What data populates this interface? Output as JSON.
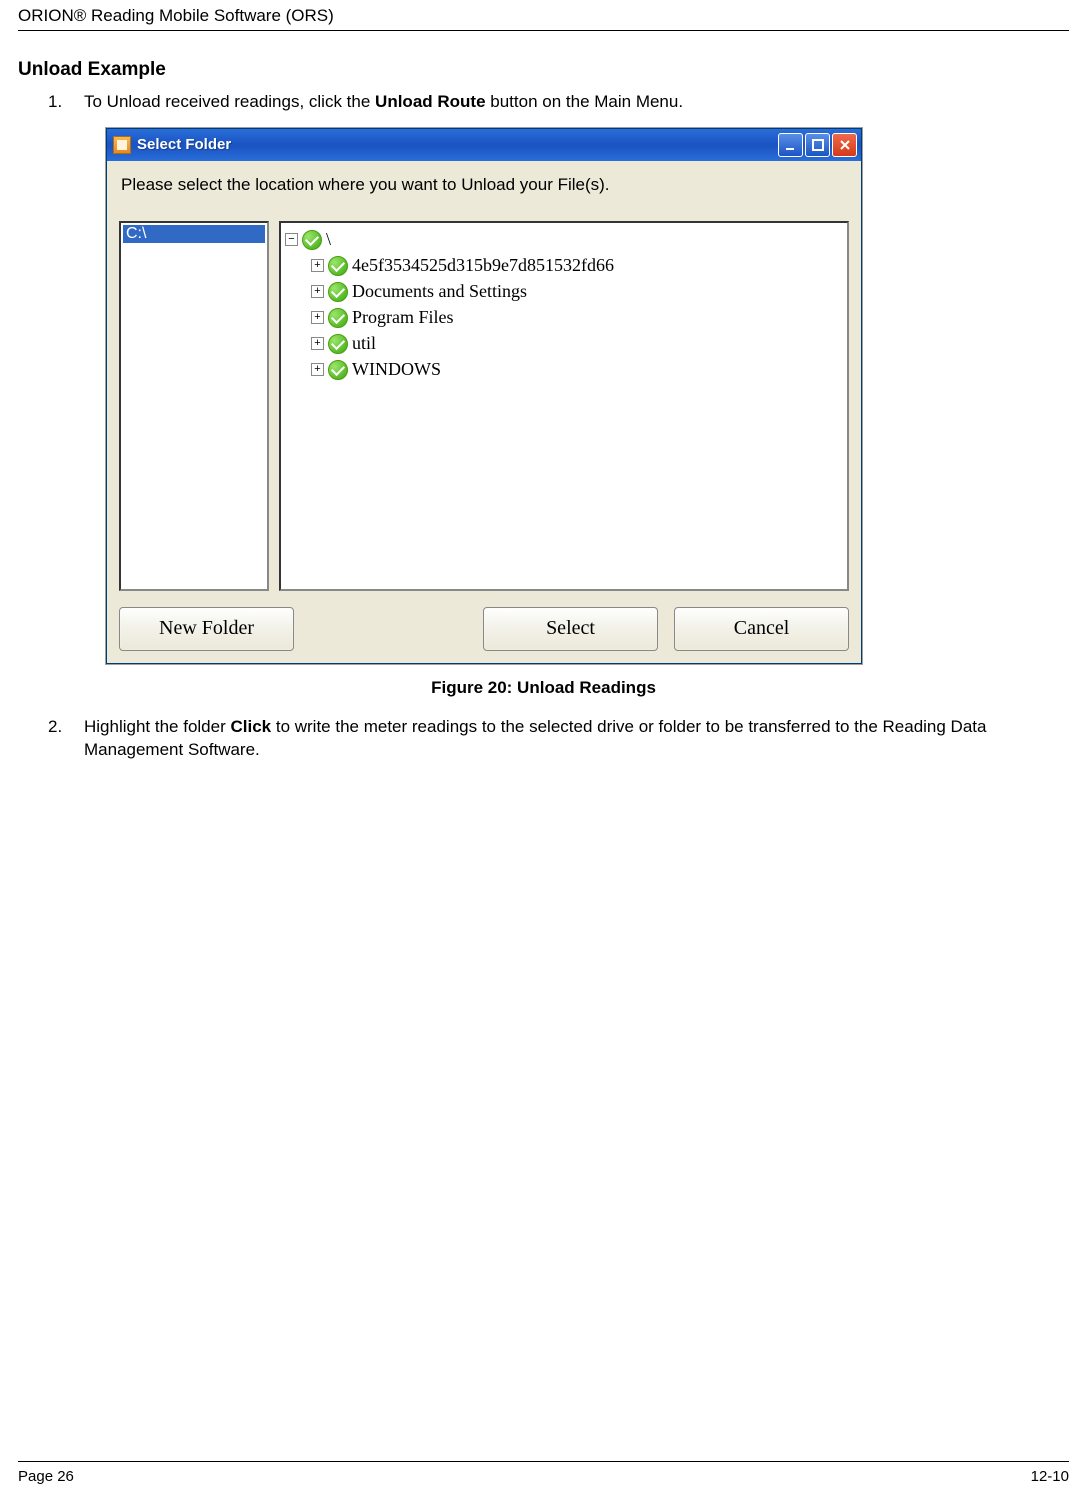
{
  "doc": {
    "header": "ORION® Reading Mobile Software (ORS)",
    "section_title": "Unload Example",
    "step1": {
      "num": "1.",
      "pre": "To Unload received readings, click the ",
      "bold": "Unload Route",
      "post": " button on the Main Menu."
    },
    "step2": {
      "num": "2.",
      "pre": "Highlight the folder ",
      "bold": "Click",
      "post": " to write the meter readings to the selected drive or folder to be transferred to the Reading Data Management Software."
    },
    "figure_caption": "Figure 20: Unload Readings",
    "footer_left": "Page 26",
    "footer_right": "12-10"
  },
  "dialog": {
    "title": "Select Folder",
    "prompt": "Please select the location where you want to Unload your File(s).",
    "drive_selected": "C:\\",
    "tree": {
      "root": "\\",
      "nodes": [
        "4e5f3534525d315b9e7d851532fd66",
        "Documents and Settings",
        "Program Files",
        "util",
        "WINDOWS"
      ]
    },
    "buttons": {
      "new_folder": "New Folder",
      "select": "Select",
      "cancel": "Cancel"
    }
  }
}
